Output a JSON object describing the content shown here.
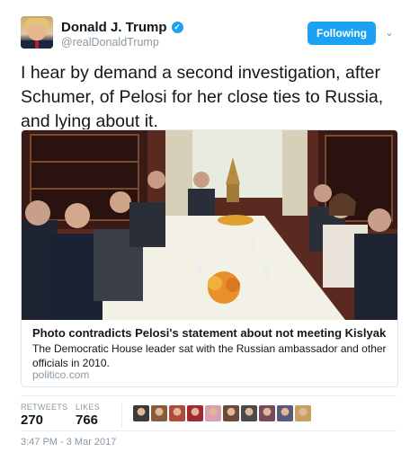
{
  "author": {
    "name": "Donald J. Trump",
    "handle": "@realDonaldTrump",
    "verified_icon": "verified-badge-icon"
  },
  "follow_button": {
    "label": "Following",
    "color": "#1da1f2"
  },
  "tweet": {
    "text": "I hear by demand a second investigation, after Schumer, of Pelosi for her close ties to Russia, and lying about it."
  },
  "card": {
    "title": "Photo contradicts Pelosi's statement about not meeting Kislyak",
    "description": "The Democratic House leader sat with the Russian ambassador and other officials in 2010.",
    "domain": "politico.com"
  },
  "stats": {
    "retweets_label": "RETWEETS",
    "retweets_count": "270",
    "likes_label": "LIKES",
    "likes_count": "766"
  },
  "liker_avatar_colors": [
    "#3a3a3a",
    "#8a5a3c",
    "#b04a3a",
    "#a02a30",
    "#d8a0b0",
    "#6a4a3a",
    "#4a4a4a",
    "#7a4a5a",
    "#5a5a7a",
    "#c8a060"
  ],
  "timestamp": "3:47 PM - 3 Mar 2017"
}
